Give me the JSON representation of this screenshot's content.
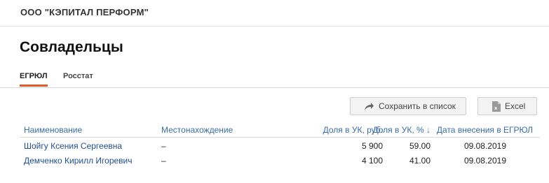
{
  "company": {
    "name": "ООО \"КЭПИТАЛ ПЕРФОРМ\""
  },
  "page": {
    "title": "Совладельцы"
  },
  "tabs": [
    {
      "label": "ЕГРЮЛ",
      "active": true
    },
    {
      "label": "Росстат",
      "active": false
    }
  ],
  "toolbar": {
    "save_label": "Сохранить в список",
    "save_icon": "share-arrow-icon",
    "excel_label": "Excel",
    "excel_icon": "excel-file-icon"
  },
  "table": {
    "headers": {
      "name": "Наименование",
      "location": "Местонахождение",
      "share_rub": "Доля в УК, руб.",
      "share_pct": "Доля в УК, % ↓",
      "date": "Дата внесения в ЕГРЮЛ"
    },
    "rows": [
      {
        "name": "Шойгу Ксения Сергеевна",
        "location": "–",
        "share_rub": "5 900",
        "share_pct": "59.00",
        "date": "09.08.2019"
      },
      {
        "name": "Демченко Кирилл Игоревич",
        "location": "–",
        "share_rub": "4 100",
        "share_pct": "41.00",
        "date": "09.08.2019"
      }
    ]
  },
  "colors": {
    "accent": "#e8562a",
    "link": "#1f4f8f",
    "header_link": "#3a6ea5"
  }
}
